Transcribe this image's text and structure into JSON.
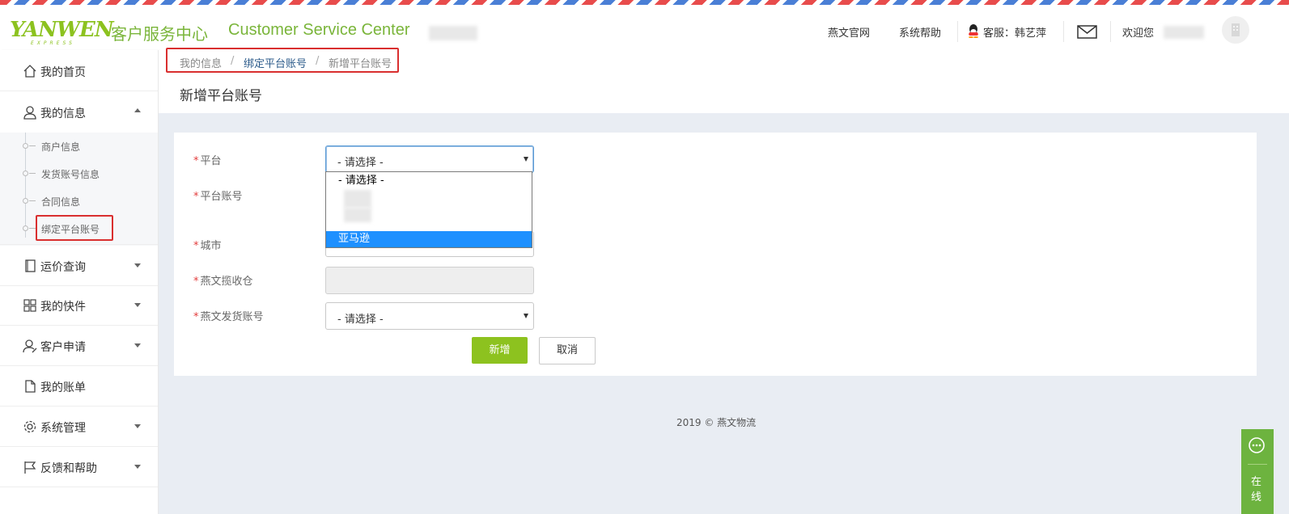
{
  "header": {
    "logo_text": "YANWEN",
    "logo_sub": "EXPRESS",
    "title_cn": "客户服务中心",
    "title_en": "Customer Service Center",
    "links": {
      "official_site": "燕文官网",
      "help": "系统帮助",
      "service": "客服：韩艺萍",
      "welcome": "欢迎您"
    }
  },
  "sidebar": {
    "home": "我的首页",
    "my_info": "我的信息",
    "sub_items": [
      "商户信息",
      "发货账号信息",
      "合同信息",
      "绑定平台账号"
    ],
    "freight_query": "运价查询",
    "my_packages": "我的快件",
    "customer_apply": "客户申请",
    "my_bill": "我的账单",
    "system_admin": "系统管理",
    "feedback_help": "反馈和帮助"
  },
  "breadcrumb": {
    "level1": "我的信息",
    "level2": "绑定平台账号",
    "level3": "新增平台账号",
    "separator": "/"
  },
  "page_title": "新增平台账号",
  "form": {
    "required_mark": "*",
    "platform_label": "平台",
    "platform_value": "- 请选择 -",
    "platform_account_label": "平台账号",
    "city_label": "城市",
    "warehouse_label": "燕文揽收仓",
    "shipping_account_label": "燕文发货账号",
    "shipping_account_value": "- 请选择 -",
    "dropdown_options": {
      "placeholder": "- 请选择 -",
      "highlighted": "亚马逊"
    },
    "submit_label": "新增",
    "cancel_label": "取消"
  },
  "footer": "2019 © 燕文物流",
  "online_service": "在线",
  "colors": {
    "brand_green": "#8dc21f",
    "title_green": "#7ab53a",
    "highlight_red": "#d92f2f",
    "option_selected": "#1e90ff"
  }
}
